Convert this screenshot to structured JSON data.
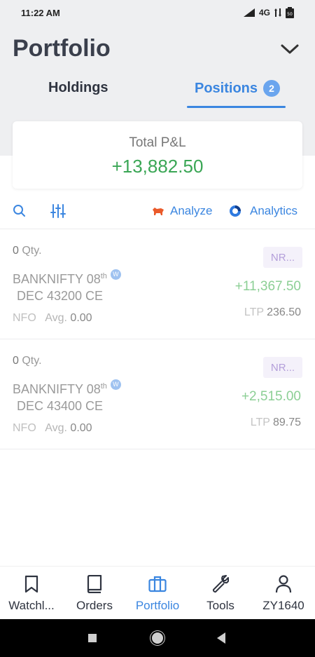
{
  "status_bar": {
    "time": "11:22 AM",
    "network": "4G",
    "battery": "50"
  },
  "header": {
    "title": "Portfolio"
  },
  "tabs": [
    {
      "label": "Holdings",
      "active": false
    },
    {
      "label": "Positions",
      "badge": "2",
      "active": true
    }
  ],
  "summary": {
    "label": "Total P&L",
    "value": "+13,882.50"
  },
  "toolbar": {
    "analyze_label": "Analyze",
    "analytics_label": "Analytics"
  },
  "positions": [
    {
      "qty_num": "0",
      "qty_label": "Qty.",
      "symbol_line1": "BANKNIFTY 08",
      "symbol_sup": "th",
      "weekly_badge": "W",
      "symbol_line2": "DEC 43200 CE",
      "exchange": "NFO",
      "avg_label": "Avg.",
      "avg_value": "0.00",
      "product": "NR...",
      "pnl": "+11,367.50",
      "ltp_label": "LTP",
      "ltp_value": "236.50"
    },
    {
      "qty_num": "0",
      "qty_label": "Qty.",
      "symbol_line1": "BANKNIFTY 08",
      "symbol_sup": "th",
      "weekly_badge": "W",
      "symbol_line2": "DEC 43400 CE",
      "exchange": "NFO",
      "avg_label": "Avg.",
      "avg_value": "0.00",
      "product": "NR...",
      "pnl": "+2,515.00",
      "ltp_label": "LTP",
      "ltp_value": "89.75"
    }
  ],
  "bottom_nav": [
    {
      "label": "Watchl...",
      "icon": "bookmark-icon"
    },
    {
      "label": "Orders",
      "icon": "book-icon"
    },
    {
      "label": "Portfolio",
      "icon": "briefcase-icon",
      "active": true
    },
    {
      "label": "Tools",
      "icon": "wrench-icon"
    },
    {
      "label": "ZY1640",
      "icon": "user-icon"
    }
  ],
  "colors": {
    "accent": "#3b86e0",
    "profit": "#3aa655",
    "profit_light": "#8ccf95",
    "header_bg": "#eeeff1",
    "chip_text": "#b49fda"
  }
}
